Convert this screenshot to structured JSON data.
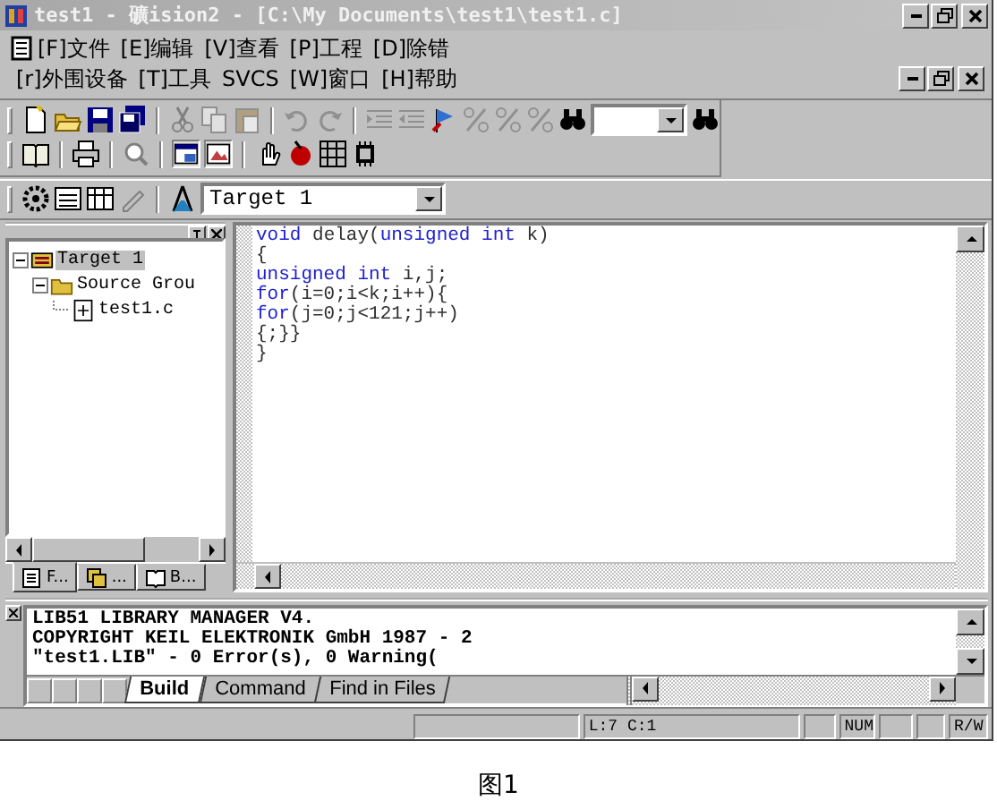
{
  "window": {
    "title": "test1  - 礦ision2 - [C:\\My Documents\\test1\\test1.c]"
  },
  "menu": {
    "rows": [
      [
        "[F]文件",
        "[E]编辑",
        "[V]查看",
        "[P]工程",
        "[D]除错"
      ],
      [
        "[r]外围设备",
        "[T]工具",
        "SVCS",
        "[W]窗口",
        "[H]帮助"
      ]
    ]
  },
  "target_select": {
    "value": "Target 1"
  },
  "project_tree": [
    {
      "kind": "target",
      "label": "Target 1",
      "selected": true,
      "expanded": true,
      "children": [
        {
          "kind": "group",
          "label": "Source Grou",
          "selected": false,
          "expanded": true,
          "children": [
            {
              "kind": "file",
              "label": "test1.c",
              "selected": false
            }
          ]
        }
      ]
    }
  ],
  "project_tabs": [
    {
      "kind": "files",
      "label": "F...",
      "selected": true
    },
    {
      "kind": "regs",
      "label": "...",
      "selected": false
    },
    {
      "kind": "books",
      "label": "B...",
      "selected": false
    }
  ],
  "editor": {
    "lines": [
      [
        {
          "kind": "keyword",
          "text": "void"
        },
        {
          "kind": "plain",
          "text": " delay("
        },
        {
          "kind": "keyword",
          "text": "unsigned int"
        },
        {
          "kind": "plain",
          "text": " k)"
        }
      ],
      [
        {
          "kind": "plain",
          "text": "{"
        }
      ],
      [
        {
          "kind": "keyword",
          "text": "unsigned int"
        },
        {
          "kind": "plain",
          "text": " i,j;"
        }
      ],
      [
        {
          "kind": "keyword",
          "text": "for"
        },
        {
          "kind": "plain",
          "text": "(i=0;i<k;i++){"
        }
      ],
      [
        {
          "kind": "keyword",
          "text": "for"
        },
        {
          "kind": "plain",
          "text": "(j=0;j<121;j++)"
        }
      ],
      [
        {
          "kind": "plain",
          "text": "{;}}"
        }
      ],
      [
        {
          "kind": "plain",
          "text": "}"
        }
      ]
    ]
  },
  "output": {
    "lines": [
      "LIB51 LIBRARY MANAGER V4.",
      "COPYRIGHT KEIL ELEKTRONIK GmbH 1987 - 2",
      "\"test1.LIB\" - 0 Error(s), 0 Warning("
    ],
    "tabs": [
      {
        "label": "Build",
        "selected": true
      },
      {
        "label": "Command",
        "selected": false
      },
      {
        "label": "Find in Files",
        "selected": false
      }
    ]
  },
  "status_bar": {
    "position": "L:7 C:1",
    "num": "NUM",
    "mode": "R/W"
  },
  "caption": "图1"
}
